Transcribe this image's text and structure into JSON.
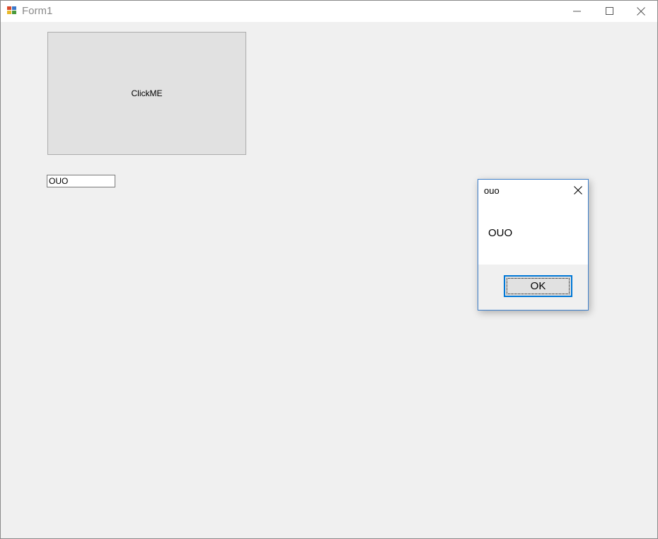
{
  "window": {
    "title": "Form1"
  },
  "form": {
    "button_label": "ClickME",
    "textbox_value": "OUO"
  },
  "message_box": {
    "title": "ouo",
    "message": "OUO",
    "ok_label": "OK"
  },
  "colors": {
    "title_text": "#8a8a8a",
    "dialog_border": "#3d7ec9",
    "focus_accent": "#0078d7"
  },
  "icons": [
    "app-icon",
    "minimize-icon",
    "maximize-icon",
    "close-icon"
  ]
}
